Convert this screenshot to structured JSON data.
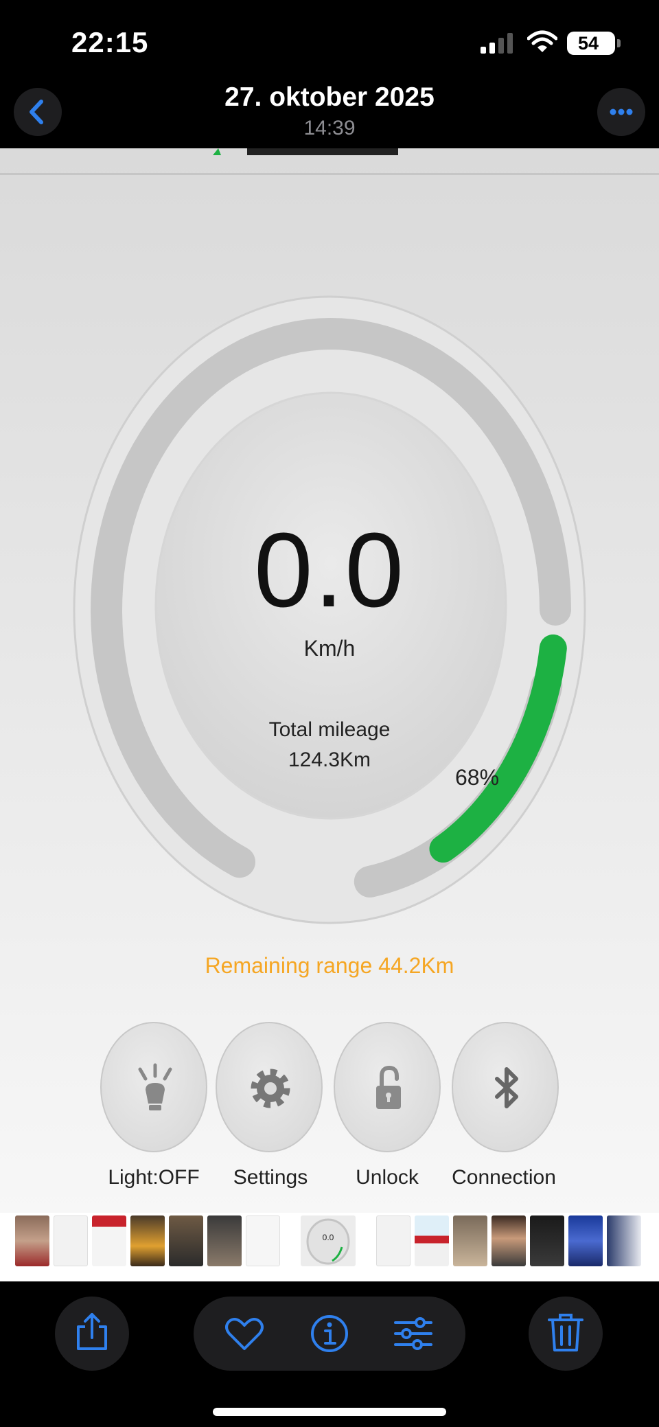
{
  "status_bar": {
    "time": "22:15",
    "battery": "54"
  },
  "header": {
    "date": "27. oktober 2025",
    "time": "14:39"
  },
  "dashboard": {
    "speed": "0.0",
    "speed_unit": "Km/h",
    "mileage_label": "Total mileage",
    "mileage_value": "124.3Km",
    "battery_percent_label": "68%",
    "battery_level_percent": 68,
    "remaining_range": "Remaining range  44.2Km",
    "accent_color": "#1db143",
    "range_color": "#f5a623",
    "controls": [
      {
        "label": "Light:OFF",
        "icon": "light-bulb-icon"
      },
      {
        "label": "Settings",
        "icon": "gear-icon"
      },
      {
        "label": "Unlock",
        "icon": "padlock-open-icon"
      },
      {
        "label": "Connection",
        "icon": "bluetooth-icon"
      }
    ]
  },
  "thumbnail_preview": {
    "speed": "0.0"
  },
  "toolbar": {
    "icons": [
      "share-icon",
      "heart-icon",
      "info-icon",
      "adjust-icon",
      "trash-icon"
    ],
    "icon_color": "#2f80ed"
  }
}
